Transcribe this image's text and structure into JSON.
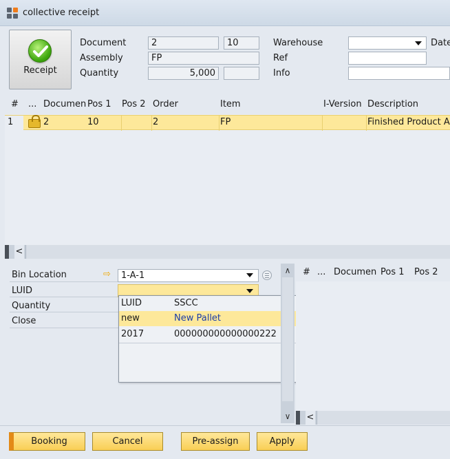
{
  "window": {
    "title": "collective receipt"
  },
  "header": {
    "receipt_label": "Receipt",
    "document_label": "Document",
    "document_value": "2",
    "document_pos": "10",
    "assembly_label": "Assembly",
    "assembly_value": "FP",
    "quantity_label": "Quantity",
    "quantity_value": "5,000",
    "warehouse_label": "Warehouse",
    "date_label": "Date",
    "ref_label": "Ref",
    "info_label": "Info"
  },
  "grid": {
    "columns": [
      "#",
      "...",
      "Documen",
      "Pos 1",
      "Pos 2",
      "Order",
      "Item",
      "I-Version",
      "Description"
    ],
    "rows": [
      {
        "num": "1",
        "document": "2",
        "pos1": "10",
        "pos2": "",
        "order": "2",
        "item": "FP",
        "iversion": "",
        "description": "Finished Product A"
      }
    ]
  },
  "form": {
    "bin_location_label": "Bin Location",
    "bin_location_value": "1-A-1",
    "luid_label": "LUID",
    "quantity_label": "Quantity",
    "close_label": "Close"
  },
  "luid_dropdown": {
    "headers": [
      "LUID",
      "SSCC"
    ],
    "options": [
      {
        "luid": "new",
        "sscc": "New Pallet",
        "selected": true
      },
      {
        "luid": "2017",
        "sscc": "000000000000000222",
        "selected": false
      }
    ]
  },
  "right_grid": {
    "columns": [
      "#",
      "...",
      "Documen",
      "Pos 1",
      "Pos 2"
    ]
  },
  "buttons": {
    "booking": "Booking",
    "cancel": "Cancel",
    "preassign": "Pre-assign",
    "apply": "Apply"
  },
  "colors": {
    "selection": "#fde89a",
    "accent": "#e38a17",
    "check_green": "#3fa80e",
    "link_blue": "#1c3ea8"
  }
}
